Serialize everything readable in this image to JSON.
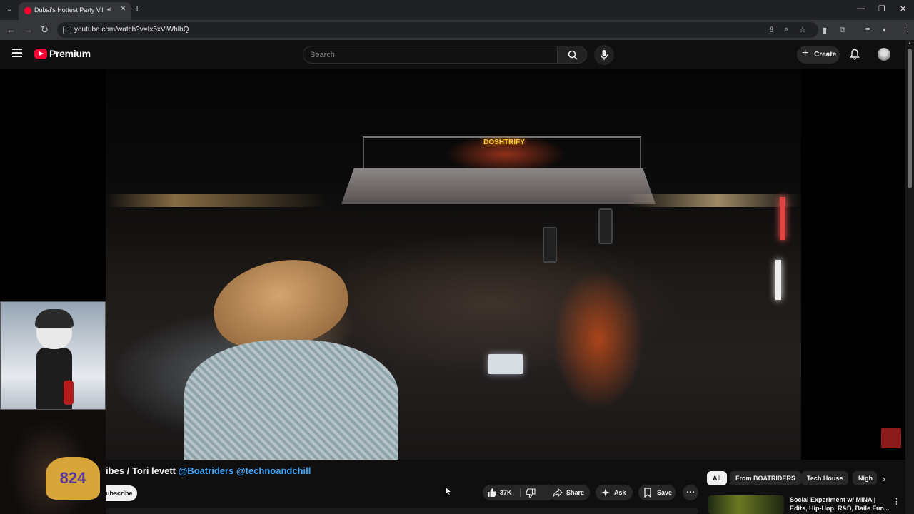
{
  "browser": {
    "tab_title": "Dubai's Hottest Party Vibe",
    "url": "youtube.com/watch?v=Ix5xVlWhlbQ"
  },
  "header": {
    "logo_text": "Premium",
    "search_placeholder": "Search",
    "create_label": "Create"
  },
  "video": {
    "title_prefix": "ibes / Tori levett ",
    "mention_1": "@Boatriders",
    "mention_2": "@technoandchill",
    "subscribe_label": "ubscribe",
    "jersey_number": "824",
    "neon_sign": "DOSHTRIFY"
  },
  "actions": {
    "like_count": "37K",
    "share_label": "Share",
    "ask_label": "Ask",
    "save_label": "Save"
  },
  "chips": [
    "All",
    "From BOATRIDERS",
    "Tech House",
    "Nigh"
  ],
  "recommendation": {
    "title": "Social Experiment w/ MINA | Edits, Hip-Hop, R&B, Baile Fun..."
  },
  "colors": {
    "brand": "#ff0033",
    "link": "#3ea6ff",
    "background": "#0f0f0f"
  }
}
